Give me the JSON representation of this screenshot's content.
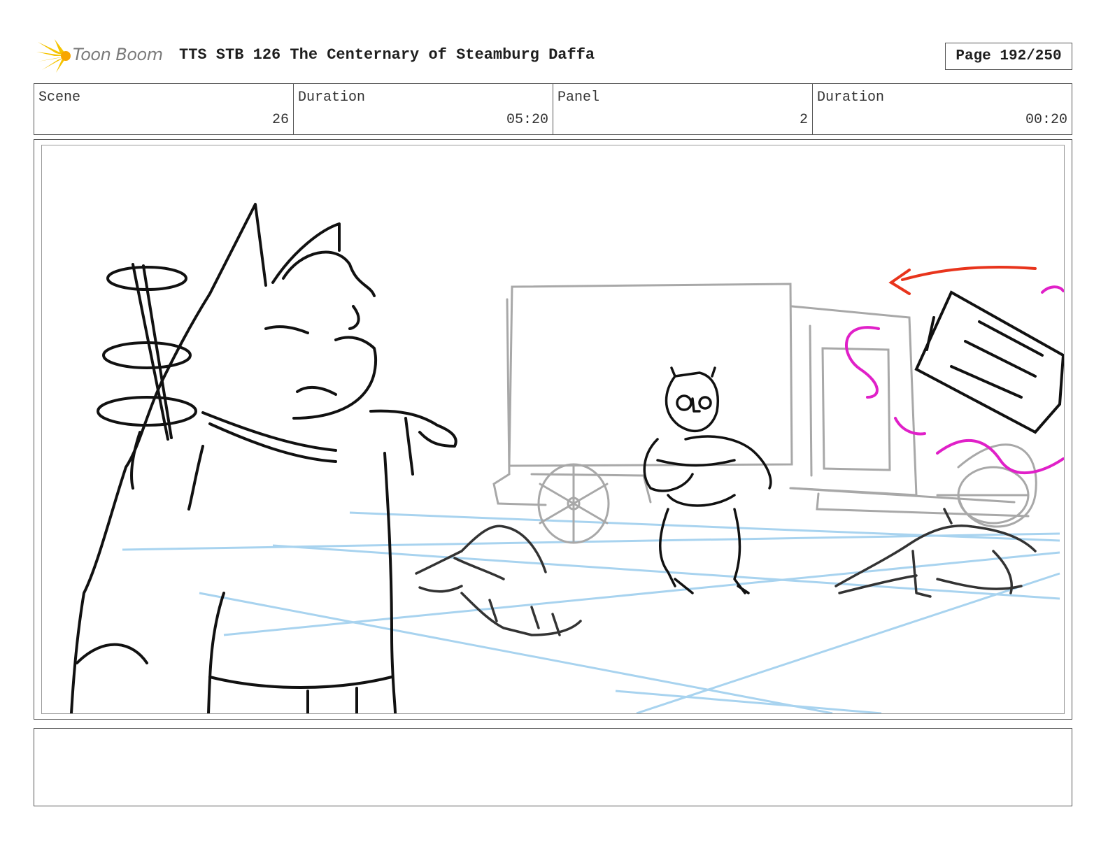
{
  "header": {
    "logo_text": "Toon Boom",
    "title": "TTS STB 126 The Centernary of Steamburg Daffa",
    "page": "Page 192/250"
  },
  "info": {
    "scene_label": "Scene",
    "scene_value": "26",
    "duration1_label": "Duration",
    "duration1_value": "05:20",
    "panel_label": "Panel",
    "panel_value": "2",
    "duration2_label": "Duration",
    "duration2_value": "00:20"
  },
  "notes": {
    "text": ""
  },
  "colors": {
    "frame": "#555555",
    "sketch": "#111111",
    "background_sketch": "#a8a8a8",
    "perspective_lines": "#9fcfee",
    "motion_arrow": "#e8341c",
    "fx_magenta": "#e020c8",
    "logo_yellow": "#f5c400"
  }
}
